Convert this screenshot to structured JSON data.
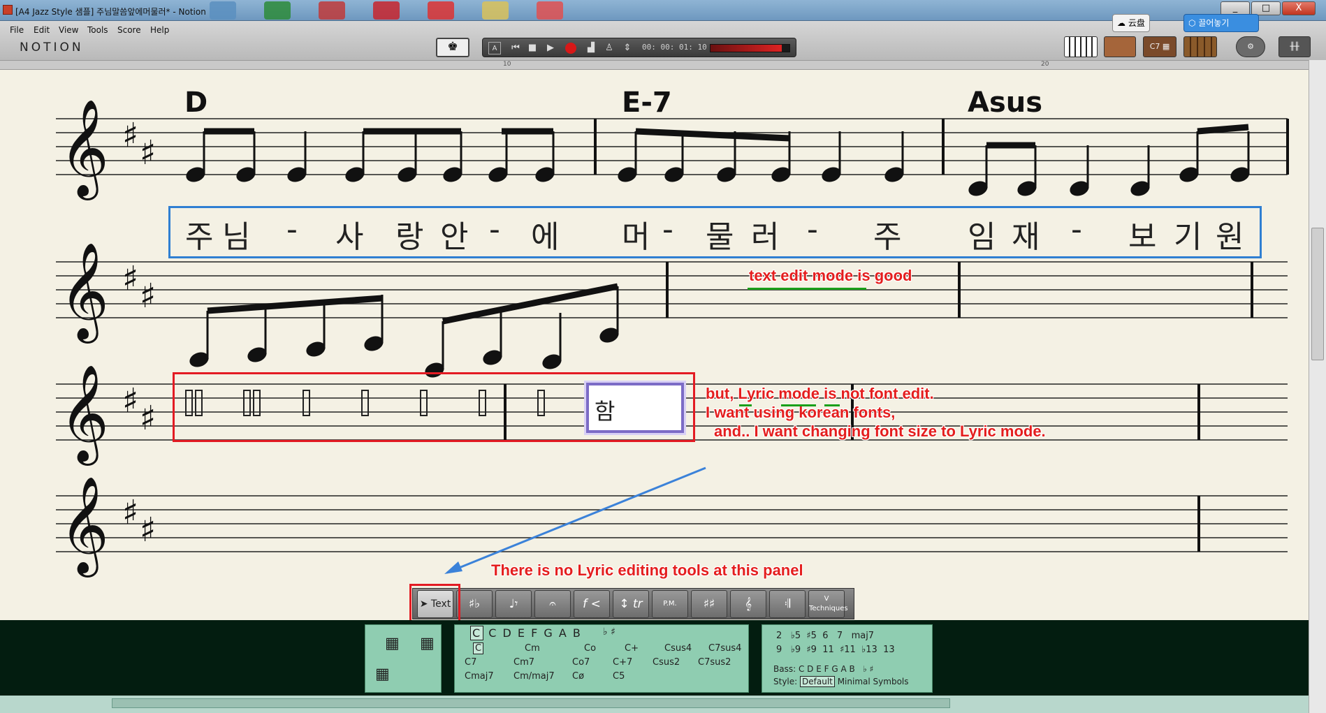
{
  "window": {
    "title": "[A4 Jazz Style 샘플] 주님말씀앞에머물러* - Notion",
    "minimize": "_",
    "maximize": "□",
    "close": "X",
    "cloud1": "云盘",
    "cloud2": "끌어놓기"
  },
  "menu": [
    "File",
    "Edit",
    "View",
    "Tools",
    "Score",
    "Help"
  ],
  "brand": "NOTION",
  "transport": {
    "timecode": "00: 00: 01: 10",
    "meter_level": 0.9
  },
  "ruler": {
    "marks": [
      "10",
      "20"
    ]
  },
  "instruments": {
    "chord": "C7"
  },
  "score": {
    "chords": [
      "D",
      "E-7",
      "Asus"
    ],
    "lyrics_text_mode": [
      "주",
      "님",
      "-",
      "사",
      "랑",
      "안",
      "-",
      "에",
      "머",
      "-",
      "물",
      "러",
      "-",
      "주",
      "임",
      "재",
      "-",
      "보",
      "기",
      "원"
    ],
    "lyric_input_value": "함"
  },
  "annotations": {
    "good": "text edit mode is good",
    "bad1": "but, Lyric mode is not font edit.",
    "bad2": "I want using korean fonts,",
    "bad3": "and.. I want changing font size to Lyric mode.",
    "panel": "There is no Lyric editing tools at this panel"
  },
  "palette": {
    "text_label": "Text",
    "techniques_v": "V",
    "techniques": "Techniques",
    "pm": "P.M."
  },
  "chord_panel": {
    "roots": "C D E F G A B",
    "accidentals": "♭ ♯",
    "row0": [
      "C",
      "Cm",
      "Co",
      "C+",
      "Csus4",
      "C7sus4"
    ],
    "row1": [
      "C7",
      "Cm7",
      "Co7",
      "C+7",
      "Csus2",
      "C7sus2"
    ],
    "row2": [
      "Cmaj7",
      "Cm/maj7",
      "Cø",
      "C5"
    ],
    "ext1": [
      "2",
      "♭5",
      "♯5",
      "6",
      "7",
      "maj7"
    ],
    "ext2": [
      "9",
      "♭9",
      "♯9",
      "11",
      "♯11",
      "♭13",
      "13"
    ],
    "bass_label": "Bass:",
    "bass_notes": "C D E F G A B",
    "bass_acc": "♭ ♯",
    "style_label": "Style:",
    "styles": [
      "Default",
      "Minimal",
      "Symbols"
    ]
  }
}
